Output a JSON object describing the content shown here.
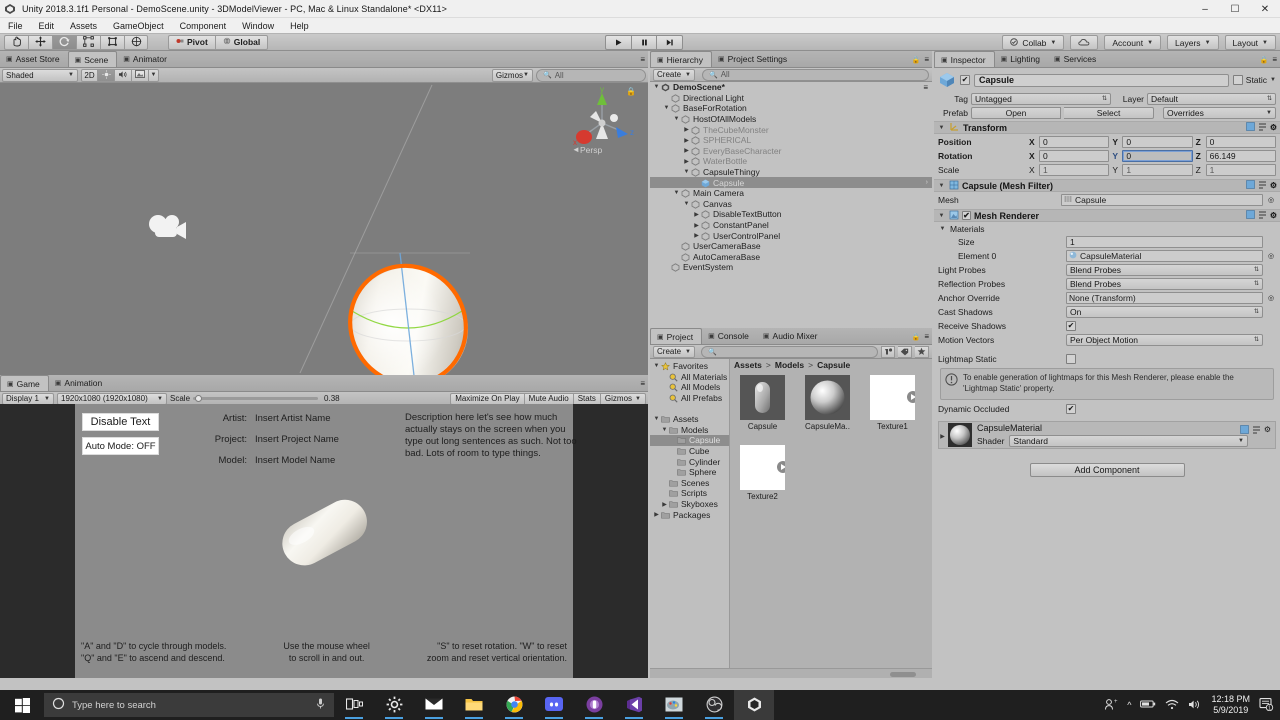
{
  "window": {
    "title": "Unity 2018.3.1f1 Personal - DemoScene.unity - 3DModelViewer - PC, Mac & Linux Standalone* <DX11>",
    "minimize": "–",
    "maximize": "☐",
    "close": "✕"
  },
  "menubar": {
    "items": [
      "File",
      "Edit",
      "Assets",
      "GameObject",
      "Component",
      "Window",
      "Help"
    ]
  },
  "toolbar": {
    "tools": [
      {
        "name": "hand-tool",
        "glyph": "✋",
        "active": false
      },
      {
        "name": "move-tool",
        "glyph": "✥",
        "active": false
      },
      {
        "name": "rotate-tool",
        "glyph": "↻",
        "active": true
      },
      {
        "name": "scale-tool",
        "glyph": "⬌",
        "active": false
      },
      {
        "name": "rect-tool",
        "glyph": "▣",
        "active": false
      },
      {
        "name": "transform-tool",
        "glyph": "✧",
        "active": false
      }
    ],
    "pivot_label": "Pivot",
    "global_label": "Global",
    "play": "▶",
    "pause": "❙❙",
    "step": "▶❙",
    "collab_label": "Collab",
    "cloud_label": "",
    "account_label": "Account",
    "layers_label": "Layers",
    "layout_label": "Layout"
  },
  "scene_panel": {
    "tabs": [
      {
        "label": "Asset Store",
        "icon": "store-icon",
        "active": false
      },
      {
        "label": "Scene",
        "icon": "grid-icon",
        "active": true
      },
      {
        "label": "Animator",
        "icon": "animator-icon",
        "active": false
      }
    ],
    "draw_mode": "Shaded",
    "mode_2d": "2D",
    "lighting_icon": "sun-icon",
    "audio_icon": "speaker-icon",
    "fx_icon": "image-icon",
    "gizmos_label": "Gizmos",
    "search_placeholder": "All",
    "persp_label": "Persp",
    "axis_labels": {
      "x": "x",
      "y": "y",
      "z": "z"
    }
  },
  "game_panel": {
    "tabs": [
      {
        "label": "Game",
        "icon": "game-icon",
        "active": true
      },
      {
        "label": "Animation",
        "icon": "animation-icon",
        "active": false
      }
    ],
    "display": "Display 1",
    "resolution": "1920x1080 (1920x1080)",
    "scale_label": "Scale",
    "scale_value": "0.38",
    "maximize_label": "Maximize On Play",
    "mute_label": "Mute Audio",
    "stats_label": "Stats",
    "gizmos_label": "Gizmos",
    "ui": {
      "disable_text_button": "Disable Text",
      "auto_mode_button": "Auto Mode: OFF",
      "info_rows": [
        {
          "label": "Artist:",
          "value": "Insert Artist Name"
        },
        {
          "label": "Project:",
          "value": "Insert Project Name"
        },
        {
          "label": "Model:",
          "value": "Insert Model Name"
        }
      ],
      "description": "Description here let's see how much actually stays on the screen when you type out long sentences as such. Not too bad. Lots of room to type things.",
      "hints": [
        "\"A\" and \"D\" to cycle through models.\n\"Q\" and \"E\" to ascend and descend.",
        "Use the mouse wheel\nto scroll in and out.",
        "\"S\" to reset rotation. \"W\" to reset\nzoom and reset vertical orientation."
      ]
    }
  },
  "hierarchy": {
    "tabs": [
      {
        "label": "Hierarchy",
        "icon": "hierarchy-icon",
        "active": true
      },
      {
        "label": "Project Settings",
        "icon": "gear-icon",
        "active": false
      }
    ],
    "create_label": "Create",
    "search_placeholder": "All",
    "scene_name": "DemoScene*",
    "items": [
      {
        "label": "Directional Light",
        "indent": 1,
        "arrow": "none",
        "selected": false,
        "dim": false
      },
      {
        "label": "BaseForRotation",
        "indent": 1,
        "arrow": "open",
        "selected": false,
        "dim": false
      },
      {
        "label": "HostOfAllModels",
        "indent": 2,
        "arrow": "open",
        "selected": false,
        "dim": false
      },
      {
        "label": "TheCubeMonster",
        "indent": 3,
        "arrow": "closed",
        "selected": false,
        "dim": true
      },
      {
        "label": "SPHERICAL",
        "indent": 3,
        "arrow": "closed",
        "selected": false,
        "dim": true
      },
      {
        "label": "EveryBaseCharacter",
        "indent": 3,
        "arrow": "closed",
        "selected": false,
        "dim": true
      },
      {
        "label": "WaterBottle",
        "indent": 3,
        "arrow": "closed",
        "selected": false,
        "dim": true
      },
      {
        "label": "CapsuleThingy",
        "indent": 3,
        "arrow": "open",
        "selected": false,
        "dim": false
      },
      {
        "label": "Capsule",
        "indent": 4,
        "arrow": "none",
        "selected": true,
        "dim": false
      },
      {
        "label": "Main Camera",
        "indent": 2,
        "arrow": "open",
        "selected": false,
        "dim": false
      },
      {
        "label": "Canvas",
        "indent": 3,
        "arrow": "open",
        "selected": false,
        "dim": false
      },
      {
        "label": "DisableTextButton",
        "indent": 4,
        "arrow": "closed",
        "selected": false,
        "dim": false
      },
      {
        "label": "ConstantPanel",
        "indent": 4,
        "arrow": "closed",
        "selected": false,
        "dim": false
      },
      {
        "label": "UserControlPanel",
        "indent": 4,
        "arrow": "closed",
        "selected": false,
        "dim": false
      },
      {
        "label": "UserCameraBase",
        "indent": 2,
        "arrow": "none",
        "selected": false,
        "dim": false
      },
      {
        "label": "AutoCameraBase",
        "indent": 2,
        "arrow": "none",
        "selected": false,
        "dim": false
      },
      {
        "label": "EventSystem",
        "indent": 1,
        "arrow": "none",
        "selected": false,
        "dim": false
      }
    ]
  },
  "project": {
    "tabs": [
      {
        "label": "Project",
        "icon": "folder-icon",
        "active": true
      },
      {
        "label": "Console",
        "icon": "console-icon",
        "active": false
      },
      {
        "label": "Audio Mixer",
        "icon": "mixer-icon",
        "active": false
      }
    ],
    "create_label": "Create",
    "search_placeholder": "",
    "tree": [
      {
        "label": "Favorites",
        "indent": 0,
        "arrow": "open",
        "icon": "star-icon",
        "selected": false
      },
      {
        "label": "All Materials",
        "indent": 1,
        "arrow": "none",
        "icon": "search-icon",
        "selected": false
      },
      {
        "label": "All Models",
        "indent": 1,
        "arrow": "none",
        "icon": "search-icon",
        "selected": false
      },
      {
        "label": "All Prefabs",
        "indent": 1,
        "arrow": "none",
        "icon": "search-icon",
        "selected": false
      },
      {
        "label": "",
        "indent": 0,
        "arrow": "none",
        "icon": "none",
        "selected": false
      },
      {
        "label": "Assets",
        "indent": 0,
        "arrow": "open",
        "icon": "folder-icon",
        "selected": false
      },
      {
        "label": "Models",
        "indent": 1,
        "arrow": "open",
        "icon": "folder-icon",
        "selected": false
      },
      {
        "label": "Capsule",
        "indent": 2,
        "arrow": "none",
        "icon": "folder-icon",
        "selected": true
      },
      {
        "label": "Cube",
        "indent": 2,
        "arrow": "none",
        "icon": "folder-icon",
        "selected": false
      },
      {
        "label": "Cylinder",
        "indent": 2,
        "arrow": "none",
        "icon": "folder-icon",
        "selected": false
      },
      {
        "label": "Sphere",
        "indent": 2,
        "arrow": "none",
        "icon": "folder-icon",
        "selected": false
      },
      {
        "label": "Scenes",
        "indent": 1,
        "arrow": "none",
        "icon": "folder-icon",
        "selected": false
      },
      {
        "label": "Scripts",
        "indent": 1,
        "arrow": "none",
        "icon": "folder-icon",
        "selected": false
      },
      {
        "label": "Skyboxes",
        "indent": 1,
        "arrow": "closed",
        "icon": "folder-icon",
        "selected": false
      },
      {
        "label": "Packages",
        "indent": 0,
        "arrow": "closed",
        "icon": "folder-icon",
        "selected": false
      }
    ],
    "breadcrumb": [
      "Assets",
      "Models",
      "Capsule"
    ],
    "assets": [
      {
        "label": "Capsule",
        "type": "mesh"
      },
      {
        "label": "CapsuleMa..",
        "type": "material"
      },
      {
        "label": "Texture1",
        "type": "texture"
      },
      {
        "label": "Texture2",
        "type": "texture"
      }
    ]
  },
  "inspector": {
    "tabs": [
      {
        "label": "Inspector",
        "icon": "inspector-icon",
        "active": true
      },
      {
        "label": "Lighting",
        "icon": "lighting-icon",
        "active": false
      },
      {
        "label": "Services",
        "icon": "services-icon",
        "active": false
      }
    ],
    "object_name": "Capsule",
    "object_enabled": true,
    "static_label": "Static",
    "tag_label": "Tag",
    "tag_value": "Untagged",
    "layer_label": "Layer",
    "layer_value": "Default",
    "prefab_label": "Prefab",
    "prefab_open": "Open",
    "prefab_select": "Select",
    "prefab_overrides": "Overrides",
    "transform": {
      "title": "Transform",
      "position_label": "Position",
      "position": {
        "x": "0",
        "y": "0",
        "z": "0"
      },
      "rotation_label": "Rotation",
      "rotation": {
        "x": "0",
        "y": "0",
        "z": "66.149"
      },
      "rotation_focused_axis": "Y",
      "scale_label": "Scale",
      "scale": {
        "x": "1",
        "y": "1",
        "z": "1"
      }
    },
    "mesh_filter": {
      "title": "Capsule (Mesh Filter)",
      "mesh_label": "Mesh",
      "mesh_value": "Capsule"
    },
    "mesh_renderer": {
      "title": "Mesh Renderer",
      "enabled": true,
      "materials_label": "Materials",
      "size_label": "Size",
      "size_value": "1",
      "element0_label": "Element 0",
      "element0_value": "CapsuleMaterial",
      "rows": [
        {
          "label": "Light Probes",
          "value": "Blend Probes",
          "type": "dropdown"
        },
        {
          "label": "Reflection Probes",
          "value": "Blend Probes",
          "type": "dropdown"
        },
        {
          "label": "Anchor Override",
          "value": "None (Transform)",
          "type": "object"
        },
        {
          "label": "Cast Shadows",
          "value": "On",
          "type": "dropdown"
        },
        {
          "label": "Receive Shadows",
          "value": "",
          "type": "checkbox-on"
        },
        {
          "label": "Motion Vectors",
          "value": "Per Object Motion",
          "type": "dropdown"
        },
        {
          "label": "Lightmap Static",
          "value": "",
          "type": "checkbox-off"
        }
      ],
      "help_text": "To enable generation of lightmaps for this Mesh Renderer, please enable the 'Lightmap Static' property.",
      "dynamic_occluded_label": "Dynamic Occluded"
    },
    "material": {
      "name": "CapsuleMaterial",
      "shader_label": "Shader",
      "shader_value": "Standard"
    },
    "add_component": "Add Component"
  },
  "taskbar": {
    "search_placeholder": "Type here to search",
    "icons": [
      {
        "name": "task-view-icon"
      },
      {
        "name": "settings-icon"
      },
      {
        "name": "mail-icon"
      },
      {
        "name": "file-explorer-icon"
      },
      {
        "name": "chrome-icon"
      },
      {
        "name": "discord-icon"
      },
      {
        "name": "slack-icon"
      },
      {
        "name": "visual-studio-icon"
      },
      {
        "name": "paint-icon"
      },
      {
        "name": "obs-icon"
      },
      {
        "name": "unity-icon"
      }
    ],
    "time": "12:18 PM",
    "date": "5/9/2019"
  },
  "colors": {
    "unity_bg": "#c2c2c2",
    "panel_header": "#b4b4b4",
    "selection": "#8d8d8d",
    "gizmo_orange": "#ff6a00",
    "accent_blue": "#4a6fa5",
    "taskbar": "#1f1f1f"
  }
}
